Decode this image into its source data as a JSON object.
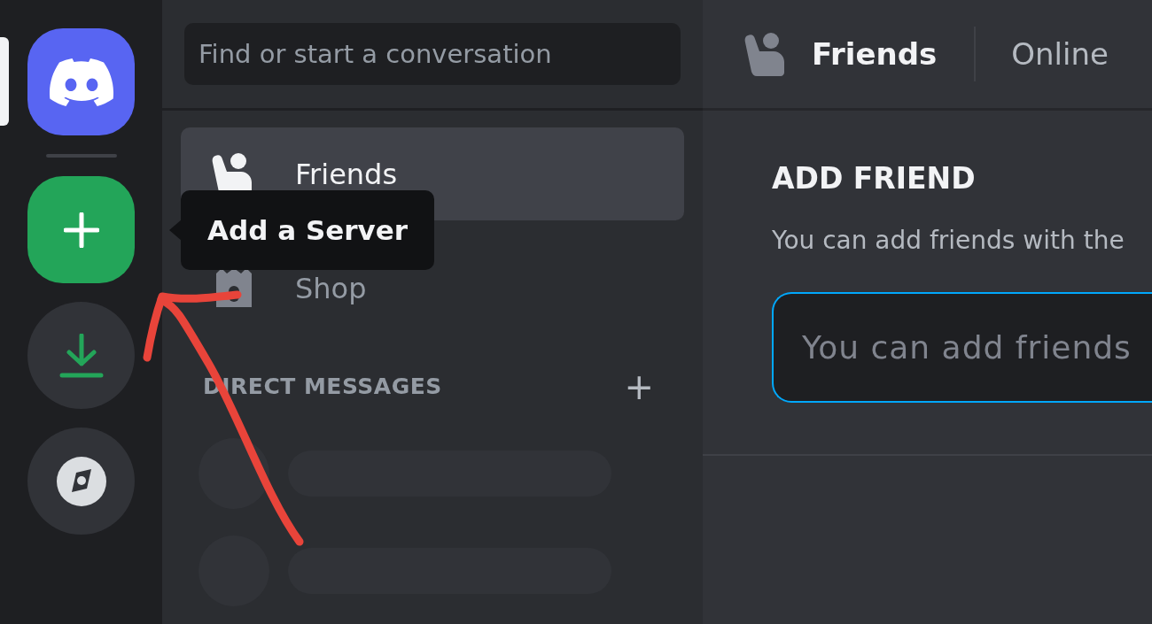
{
  "server_rail": {
    "items": [
      {
        "kind": "home",
        "selected": true
      },
      {
        "kind": "add",
        "selected": false
      },
      {
        "kind": "download",
        "selected": false
      },
      {
        "kind": "explore",
        "selected": false
      }
    ]
  },
  "tooltip": {
    "text": "Add a Server"
  },
  "sidebar": {
    "search": {
      "placeholder": "Find or start a conversation"
    },
    "items": [
      {
        "kind": "friends",
        "label": "Friends",
        "selected": true
      },
      {
        "kind": "shop",
        "label": "Shop",
        "selected": false
      }
    ],
    "direct_messages": {
      "title": "DIRECT MESSAGES",
      "add": "+"
    },
    "conversations": [
      {
        "kind": "skeleton"
      },
      {
        "kind": "skeleton"
      }
    ]
  },
  "header": {
    "title": "Friends",
    "tabs": [
      {
        "label": "Online",
        "selected": false
      }
    ]
  },
  "add_friend": {
    "title": "ADD FRIEND",
    "description": "You can add friends with the",
    "input": {
      "placeholder": "You can add friends"
    }
  },
  "annotation": {
    "kind": "arrow"
  }
}
